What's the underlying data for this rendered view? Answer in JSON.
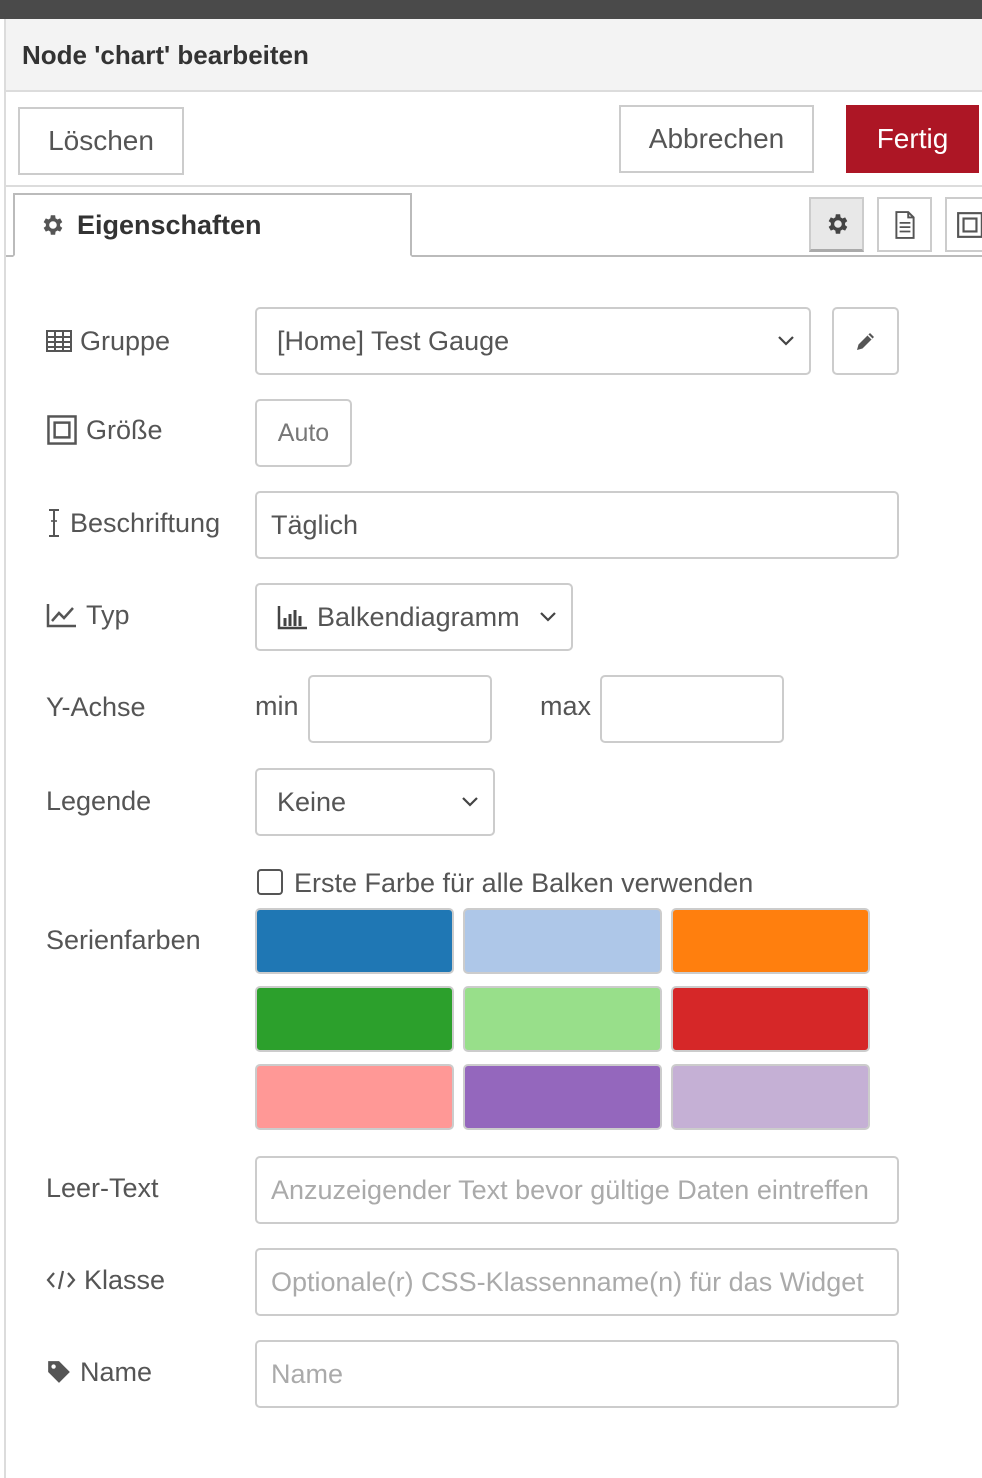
{
  "header": {
    "title": "Node 'chart' bearbeiten"
  },
  "toolbar": {
    "delete_label": "Löschen",
    "cancel_label": "Abbrechen",
    "done_label": "Fertig"
  },
  "tabs": {
    "properties_label": "Eigenschaften"
  },
  "form": {
    "group": {
      "label": "Gruppe",
      "value": "[Home] Test Gauge"
    },
    "size": {
      "label": "Größe",
      "value": "Auto"
    },
    "caption": {
      "label": "Beschriftung",
      "value": "Täglich"
    },
    "type": {
      "label": "Typ",
      "value": "Balkendiagramm"
    },
    "y_axis": {
      "label": "Y-Achse",
      "min_label": "min",
      "min_value": "",
      "max_label": "max",
      "max_value": ""
    },
    "legend": {
      "label": "Legende",
      "value": "Keine"
    },
    "use_first_color": {
      "label": "Erste Farbe für alle Balken verwenden",
      "checked": false
    },
    "series_colors": {
      "label": "Serienfarben",
      "colors": [
        "#1f77b4",
        "#aec7e8",
        "#ff7f0e",
        "#2ca02c",
        "#98df8a",
        "#d62728",
        "#ff9896",
        "#9467bd",
        "#c5b0d5"
      ]
    },
    "empty_text": {
      "label": "Leer-Text",
      "placeholder": "Anzuzeigender Text bevor gültige Daten eintreffen"
    },
    "class": {
      "label": "Klasse",
      "placeholder": "Optionale(r) CSS-Klassenname(n) für das Widget"
    },
    "name": {
      "label": "Name",
      "placeholder": "Name"
    }
  },
  "colors": {
    "done_button": "#ad1625",
    "topbar": "#4a4a4a",
    "header_bg": "#f3f3f3"
  }
}
